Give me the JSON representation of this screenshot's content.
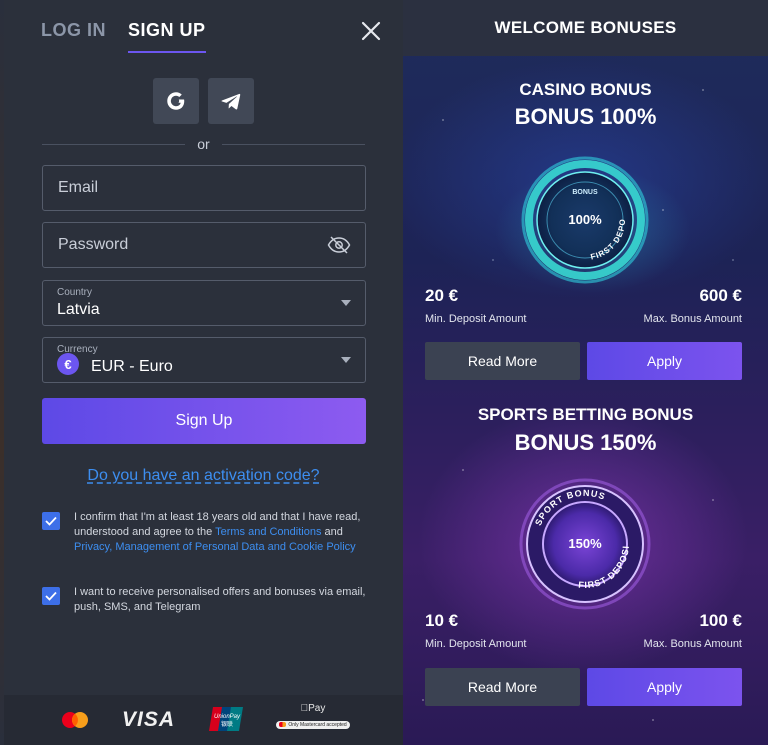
{
  "tabs": [
    {
      "label": "LOG IN",
      "active": false
    },
    {
      "label": "SIGN UP",
      "active": true
    }
  ],
  "social": {
    "google": "google-icon",
    "telegram": "telegram-icon"
  },
  "or_text": "or",
  "form": {
    "email_placeholder": "Email",
    "password_placeholder": "Password",
    "country_label": "Country",
    "country_value": "Latvia",
    "currency_label": "Currency",
    "currency_symbol": "€",
    "currency_value": "EUR - Euro",
    "submit_label": "Sign Up"
  },
  "activation_link": "Do you have an activation code?",
  "consents": [
    {
      "checked": true,
      "text_before": "I confirm that I'm at least 18 years old and that I have read, understood and agree to the ",
      "link1": "Terms and Conditions",
      "text_middle": " and ",
      "link2": "Privacy, Management of Personal Data and Cookie Policy"
    },
    {
      "checked": true,
      "text": "I want to receive personalised offers and bonuses via email, push, SMS, and Telegram"
    }
  ],
  "payments": {
    "visa": "VISA",
    "unionpay": "UnionPay",
    "unionpay_cn": "银联",
    "applepay": "Pay",
    "applepay_note": "Only Mastercard accepted"
  },
  "bonuses": {
    "header": "WELCOME BONUSES",
    "items": [
      {
        "category": "CASINO BONUS",
        "headline": "BONUS 100%",
        "badge_top": "BONUS",
        "badge_pct": "100%",
        "badge_ring": "FIRST DEPOSIT",
        "min_amount": "20 €",
        "min_label": "Min. Deposit Amount",
        "max_amount": "600 €",
        "max_label": "Max. Bonus Amount",
        "read_more": "Read More",
        "apply": "Apply"
      },
      {
        "category": "SPORTS BETTING BONUS",
        "headline": "BONUS 150%",
        "badge_top": "SPORT BONUS",
        "badge_pct": "150%",
        "badge_ring": "FIRST DEPOSIT",
        "min_amount": "10 €",
        "min_label": "Min. Deposit Amount",
        "max_amount": "100 €",
        "max_label": "Max. Bonus Amount",
        "read_more": "Read More",
        "apply": "Apply"
      }
    ]
  },
  "colors": {
    "accent": "#6c56f0",
    "link": "#3d8ef0",
    "panel": "#2b303b",
    "checkbox": "#3d6fe8"
  }
}
